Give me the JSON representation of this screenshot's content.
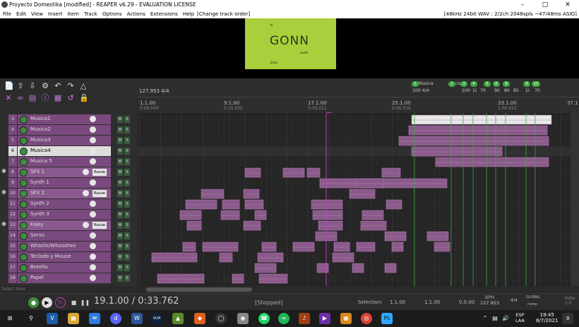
{
  "window": {
    "title": "Proyecto Domestika [modified] - REAPER v6.29 - EVALUATION LICENSE"
  },
  "menu": {
    "items": [
      "File",
      "Edit",
      "View",
      "Insert",
      "Item",
      "Track",
      "Options",
      "Actions",
      "Extensions",
      "Help"
    ],
    "extra": "[Change track order]",
    "status": "[48kHz 24bit WAV : 2/2ch 2048spls ~47/48ms ASIO]"
  },
  "video": {
    "logo": "GONN",
    "small1": "Ki",
    "small2": "Ertas",
    "small3": "audio"
  },
  "ruler": {
    "tempo": "127.953 4/4",
    "ticks": [
      {
        "label": "1.1.00",
        "time": "0:00.000"
      },
      {
        "label": "9.1.00",
        "time": "0:15.005"
      },
      {
        "label": "17.1.00",
        "time": "0:30.011"
      },
      {
        "label": "25.1.00",
        "time": "0:45.016"
      },
      {
        "label": "33.1.00",
        "time": "1:00.021"
      },
      {
        "label": "37.1",
        "time": ""
      }
    ],
    "markers": [
      {
        "num": "1",
        "label": "Musica"
      },
      {
        "num": "2",
        "label": "ca"
      },
      {
        "num": "3",
        "label": ""
      },
      {
        "num": "4",
        "label": ""
      },
      {
        "num": "5",
        "label": ""
      },
      {
        "num": "6",
        "label": ""
      },
      {
        "num": "8",
        "label": ""
      },
      {
        "num": "9",
        "label": ""
      },
      {
        "num": "10",
        "label": ""
      }
    ],
    "tempo_labels": [
      "100 4/4",
      "100",
      "1(",
      "70",
      "90",
      "80",
      "85",
      "1(",
      "70"
    ]
  },
  "tracks": [
    {
      "num": "3",
      "name": "Musica1"
    },
    {
      "num": "4",
      "name": "Musica2"
    },
    {
      "num": "5",
      "name": "Musica3"
    },
    {
      "num": "6",
      "name": "Musica4",
      "selected": true
    },
    {
      "num": "7",
      "name": "Musica 5"
    },
    {
      "num": "8",
      "name": "SFX 1",
      "folder": true,
      "route": "Route"
    },
    {
      "num": "9",
      "name": "Synth 1"
    },
    {
      "num": "10",
      "name": "SFX 2",
      "folder": true,
      "route": "Route"
    },
    {
      "num": "11",
      "name": "Synth 2"
    },
    {
      "num": "12",
      "name": "Synth 3"
    },
    {
      "num": "13",
      "name": "Foley",
      "folder": true,
      "route": "Route"
    },
    {
      "num": "14",
      "name": "Servo"
    },
    {
      "num": "15",
      "name": "Whistle/Whooshes"
    },
    {
      "num": "16",
      "name": "Teclado y Mouse"
    },
    {
      "num": "17",
      "name": "Botella"
    },
    {
      "num": "18",
      "name": "Papel"
    }
  ],
  "mute_label": "M",
  "solo_label": "S",
  "transport": {
    "position": "19.1.00 / 0:33.762",
    "state": "[Stopped]",
    "selection_label": "Selection:",
    "sel_start": "1.1.00",
    "sel_end": "1.1.00",
    "sel_len": "0.0.00",
    "bpm_label": "BPM",
    "bpm": "127.953",
    "sig": "4/4",
    "global": "GLOBAL",
    "none": "none",
    "rate_label": "Rate:",
    "rate": "1.0",
    "select_time": "Select time"
  },
  "taskbar": {
    "lang1": "ESP",
    "lang2": "LAA",
    "time": "19:45",
    "date": "8/7/2021",
    "notif": "9"
  },
  "colors": {
    "track": "#7a4a7e",
    "accent": "#c03cc0",
    "marker": "#3ea83e",
    "item": "#8a5a8a"
  }
}
